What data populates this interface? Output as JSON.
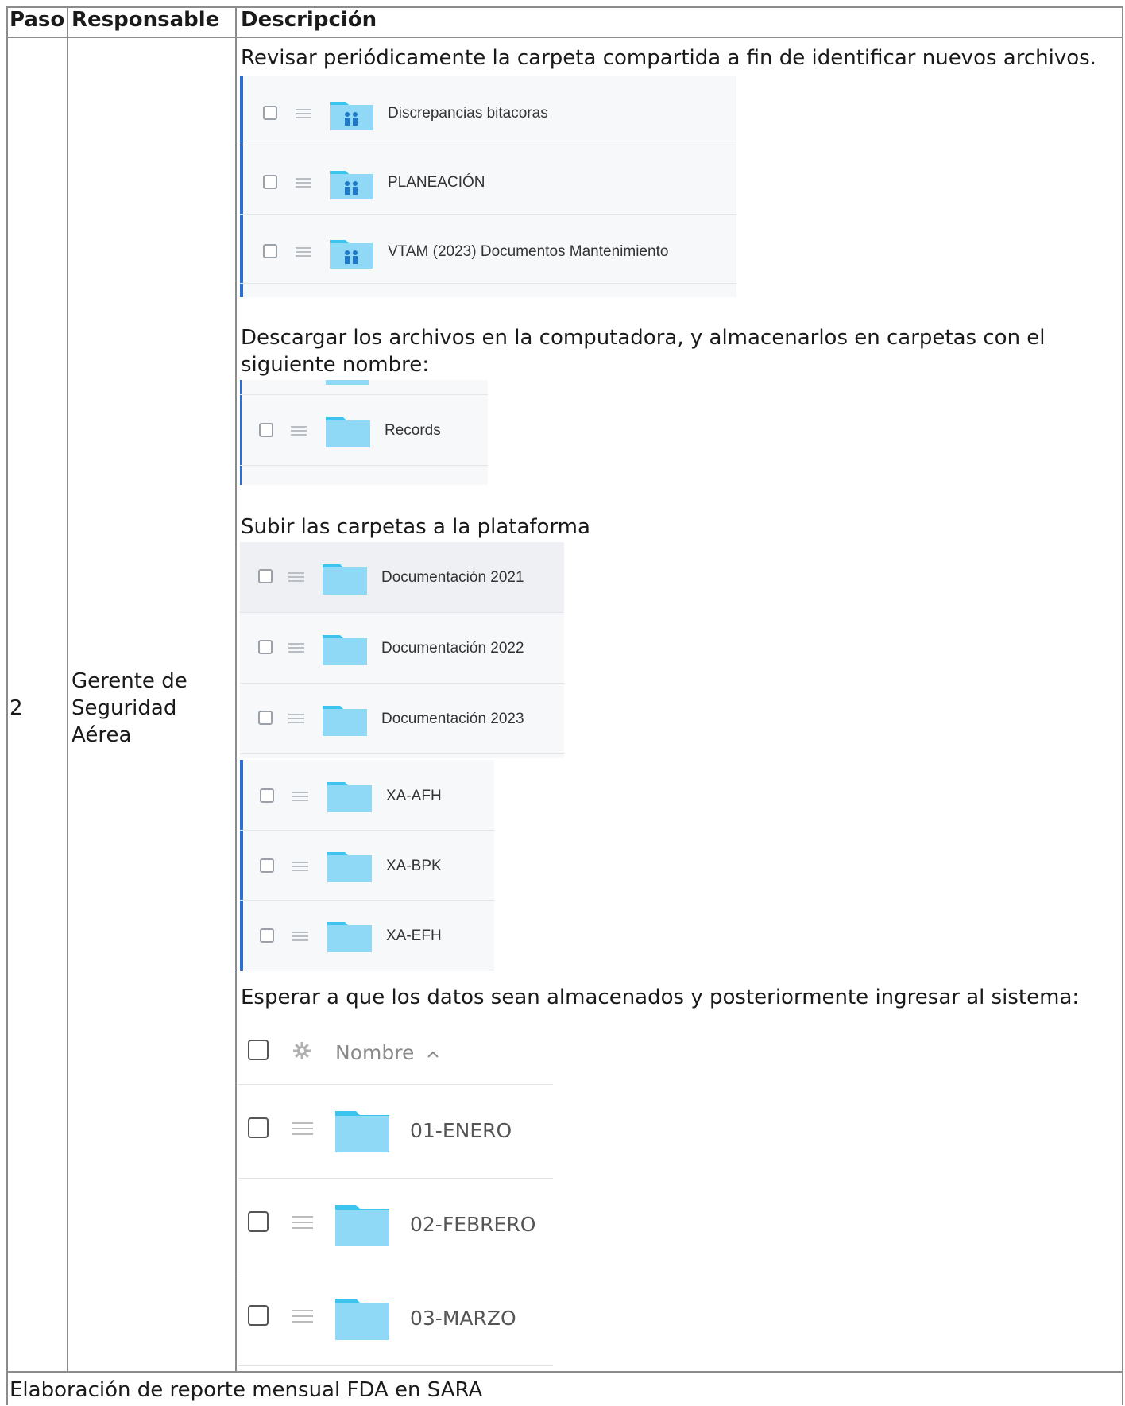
{
  "table": {
    "headers": {
      "step": "Paso",
      "responsible": "Responsable",
      "description": "Descripción"
    },
    "row": {
      "step": "2",
      "responsible": [
        "Gerente de",
        "Seguridad",
        "Aérea"
      ],
      "instructions": [
        "Revisar periódicamente la carpeta compartida a fin de identificar nuevos archivos.",
        "Descargar los archivos en la computadora, y almacenarlos en carpetas con el",
        "siguiente nombre:",
        "Subir las carpetas a la plataforma",
        "Esperar a que los datos sean almacenados y posteriormente ingresar al sistema:"
      ]
    },
    "footer": "Elaboración de reporte mensual FDA en SARA"
  },
  "screenshots": {
    "shared_folders": [
      "Discrepancias bitacoras",
      "PLANEACIÓN",
      "VTAM (2023) Documentos Mantenimiento"
    ],
    "records_folder": [
      "Records"
    ],
    "doc_folders": [
      "Documentación 2021",
      "Documentación 2022",
      "Documentación 2023"
    ],
    "aircraft_folders": [
      "XA-AFH",
      "XA-BPK",
      "XA-EFH"
    ],
    "system_view": {
      "column_header": "Nombre",
      "sort_indicator": "^",
      "folders": [
        "01-ENERO",
        "02-FEBRERO",
        "03-MARZO"
      ]
    }
  },
  "colors": {
    "folder": "#8fd9f6",
    "folder_tab": "#3cc3ee",
    "accent": "#2b6fd6",
    "shared_icon": "#1f78c8"
  }
}
